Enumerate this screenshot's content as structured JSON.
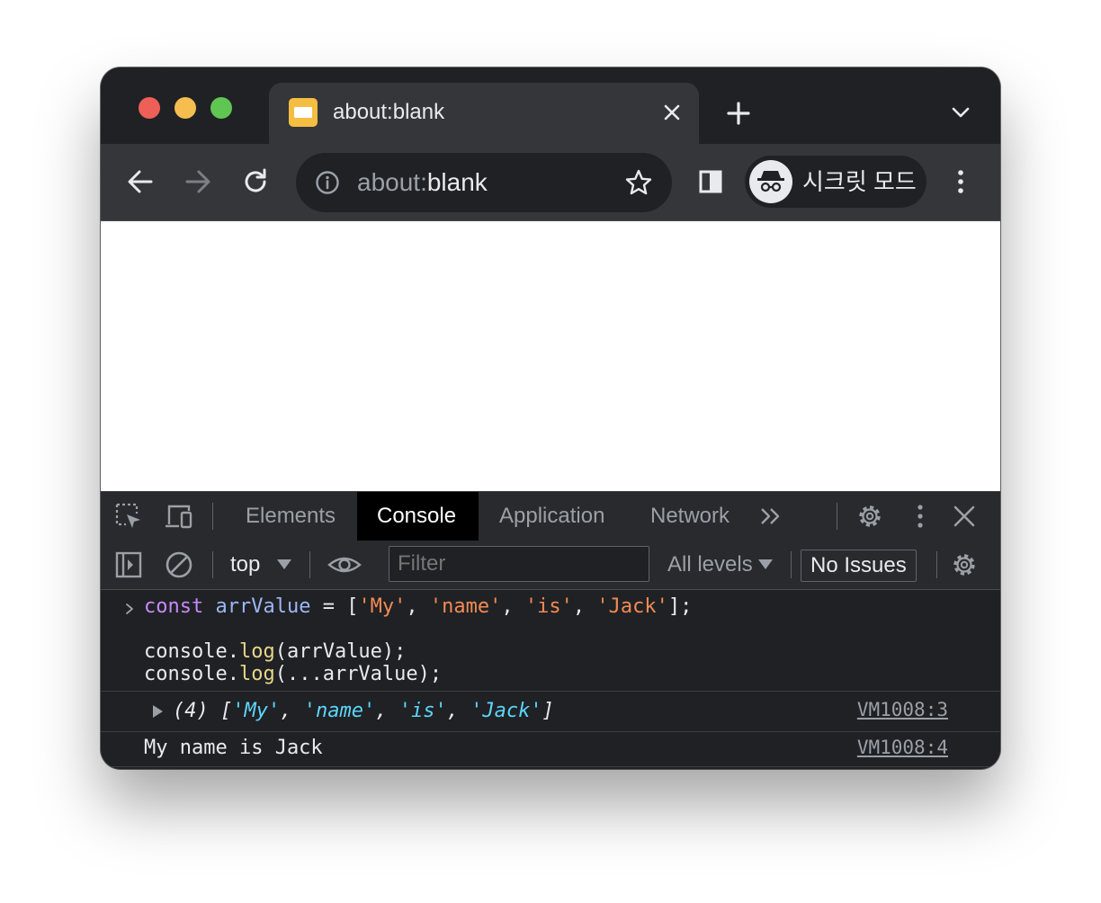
{
  "window": {
    "tab": {
      "title": "about:blank"
    },
    "omnibox": {
      "scheme": "about:",
      "path": "blank"
    },
    "incognito": {
      "label": "시크릿 모드"
    }
  },
  "devtools": {
    "tabs": [
      {
        "label": "Elements",
        "active": false
      },
      {
        "label": "Console",
        "active": true
      },
      {
        "label": "Application",
        "active": false
      },
      {
        "label": "Network",
        "active": false
      }
    ],
    "toolbar": {
      "context": "top",
      "filter_placeholder": "Filter",
      "levels": "All levels",
      "issues": "No Issues"
    },
    "console": {
      "input": {
        "line1": {
          "kw": "const",
          "var": "arrValue",
          "eq": " = [",
          "s1": "'My'",
          "s2": "'name'",
          "s3": "'is'",
          "s4": "'Jack'",
          "end": "];"
        },
        "line3": {
          "obj": "console.",
          "fn": "log",
          "args": "(arrValue);"
        },
        "line4": {
          "obj": "console.",
          "fn": "log",
          "args": "(...arrValue);"
        }
      },
      "output_array": {
        "prefix": "(4) [",
        "items": [
          "'My'",
          "'name'",
          "'is'",
          "'Jack'"
        ],
        "suffix": "]",
        "source": "VM1008:3"
      },
      "output_log": {
        "text": "My name is Jack",
        "source": "VM1008:4"
      }
    }
  },
  "colors": {
    "frame": "#202124",
    "toolbar": "#35363a",
    "keyword": "#c58af9",
    "variable": "#9cb7f5",
    "string": "#f28b54",
    "function": "#e6d78a",
    "output_string": "#5cd5fb"
  },
  "icons": {
    "window": [
      "close-traffic-light",
      "minimize-traffic-light",
      "zoom-traffic-light",
      "tab-favicon",
      "close-icon",
      "plus-icon",
      "chevron-down-icon"
    ],
    "toolbar": [
      "back-arrow-icon",
      "forward-arrow-icon",
      "reload-icon",
      "info-icon",
      "star-icon",
      "side-panel-icon",
      "incognito-icon",
      "kebab-menu-icon"
    ],
    "devtools": [
      "inspect-element-icon",
      "device-toolbar-icon",
      "more-tabs-icon",
      "gear-icon",
      "kebab-menu-icon",
      "close-icon",
      "sidebar-toggle-icon",
      "clear-console-icon",
      "eye-icon",
      "prompt-chevron-icon",
      "expand-triangle-icon"
    ]
  }
}
